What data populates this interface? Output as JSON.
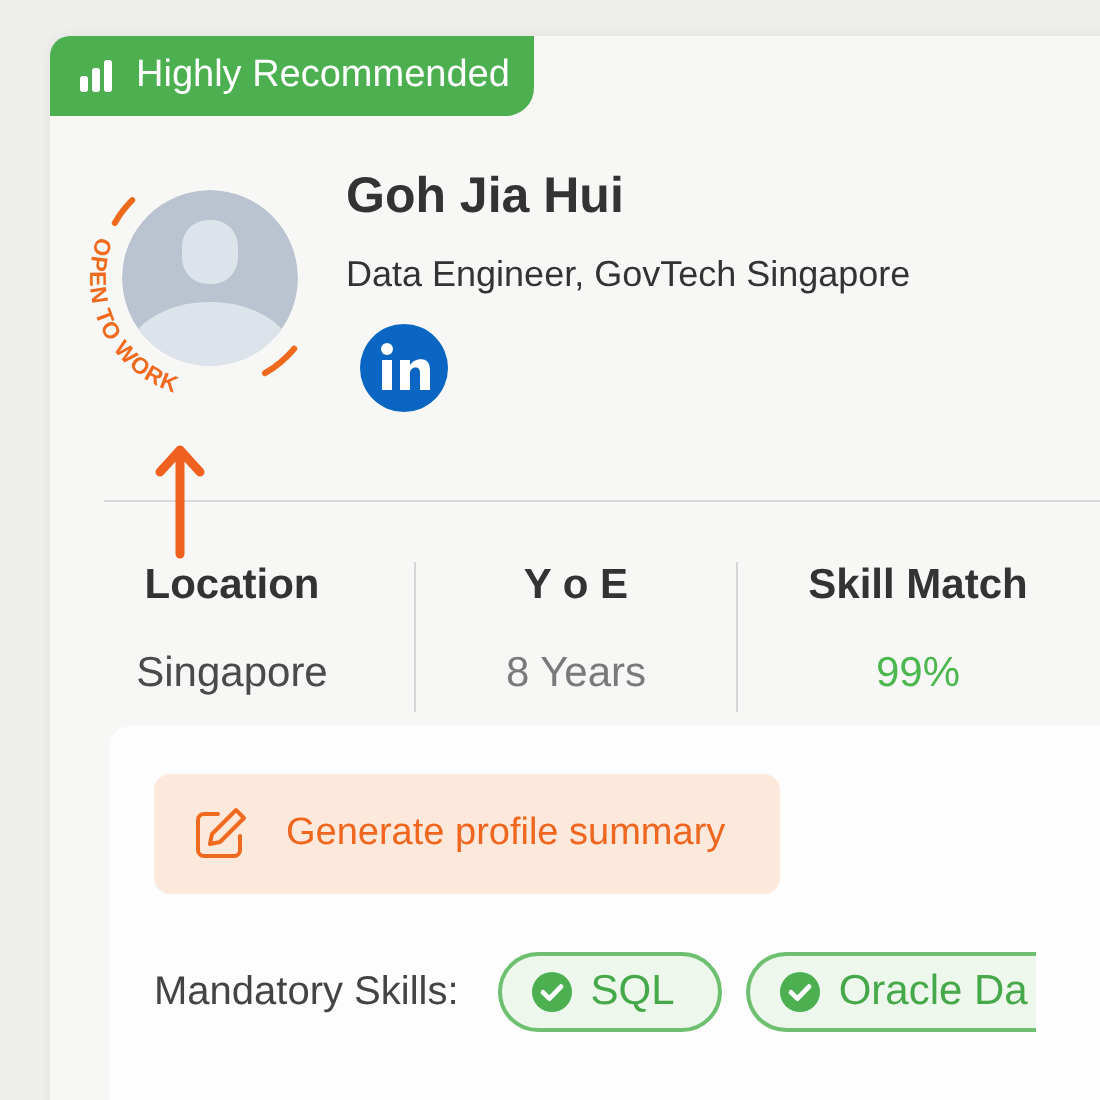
{
  "badge": {
    "label": "Highly Recommended"
  },
  "profile": {
    "name": "Goh Jia Hui",
    "title": "Data Engineer, GovTech Singapore",
    "open_to_work": "OPEN TO WORK"
  },
  "stats": [
    {
      "label": "Location",
      "value": "Singapore",
      "color": "#4a4a4a"
    },
    {
      "label": "Y o E",
      "value": "8 Years",
      "color": "#7a7a7a"
    },
    {
      "label": "Skill Match",
      "value": "99%",
      "color": "#4cb84f"
    }
  ],
  "summary_button": {
    "label": "Generate profile summary"
  },
  "mandatory_skills": {
    "label": "Mandatory Skills:",
    "skills": [
      {
        "label": "SQL"
      },
      {
        "label": "Oracle Da"
      }
    ]
  }
}
